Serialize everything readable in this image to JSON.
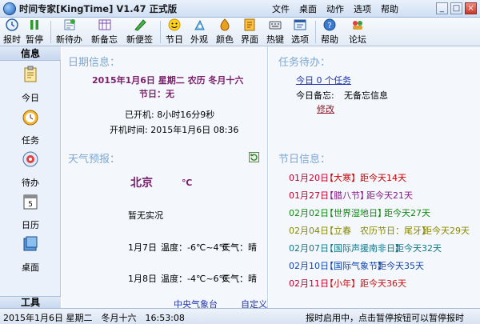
{
  "window": {
    "title": "时间专家[KingTime] V1.47 正式版",
    "menu": [
      "文件",
      "桌面",
      "动作",
      "选项",
      "帮助"
    ],
    "controls": [
      "_",
      "□",
      "×"
    ]
  },
  "toolbar": {
    "buttons": [
      {
        "label": "报时",
        "icon": "clock-icon"
      },
      {
        "label": "暂停",
        "icon": "pause-icon"
      },
      {
        "label": "新待办",
        "icon": "new-todo-icon"
      },
      {
        "label": "新备忘",
        "icon": "new-memo-icon"
      },
      {
        "label": "新便签",
        "icon": "new-note-icon"
      },
      {
        "label": "节日",
        "icon": "smiley-icon"
      },
      {
        "label": "外观",
        "icon": "appearance-icon"
      },
      {
        "label": "颜色",
        "icon": "color-icon"
      },
      {
        "label": "界面",
        "icon": "interface-icon"
      },
      {
        "label": "热键",
        "icon": "hotkey-icon"
      },
      {
        "label": "选项",
        "icon": "options-icon"
      },
      {
        "label": "帮助",
        "icon": "help-icon"
      },
      {
        "label": "论坛",
        "icon": "forum-icon"
      }
    ]
  },
  "sidebar": {
    "header": "信息",
    "items": [
      {
        "label": "今日",
        "icon": "today-icon"
      },
      {
        "label": "任务",
        "icon": "task-icon"
      },
      {
        "label": "待办",
        "icon": "todo-icon"
      },
      {
        "label": "日历",
        "icon": "calendar-icon"
      },
      {
        "label": "桌面",
        "icon": "desktop-icon"
      }
    ],
    "footer": "工具"
  },
  "date_info": {
    "title": "日期信息：",
    "date_line": "2015年1月6日 星期二 农历 冬月十六",
    "festival": "节日：无",
    "uptime": "已开机: 8小时16分9秒",
    "boot_time": "开机时间: 2015年1月6日 08:36"
  },
  "weather": {
    "title": "天气预报：",
    "city": "北京",
    "temp_unit": "℃",
    "current": "暂无实况",
    "forecast": [
      {
        "date": "1月7日",
        "temp": "温度：-6℃~4℃",
        "cond": "天气：晴"
      },
      {
        "date": "1月8日",
        "temp": "温度：-4℃~6℃",
        "cond": "天气：晴"
      }
    ],
    "source_link": "中央气象台",
    "custom_link": "自定义"
  },
  "tasks": {
    "title": "任务待办：",
    "today_tasks": "今日 0 个任务",
    "memo_label": "今日备忘:",
    "memo_value": "无备忘信息",
    "edit_link": "修改"
  },
  "holidays": {
    "title": "节日信息：",
    "items": [
      {
        "date": "01月20日",
        "name": "【大寒】",
        "days": "距今天14天",
        "color": "#cc0000"
      },
      {
        "date": "01月27日",
        "name": "【腊八节】",
        "days": "距今天21天",
        "color": "#8a1a8a"
      },
      {
        "date": "02月02日",
        "name": "【世界湿地日】",
        "days": "距今天27天",
        "color": "#118811"
      },
      {
        "date": "02月04日",
        "name": "【立春　农历节日：尾牙】",
        "days": "距今天29天",
        "color": "#888800"
      },
      {
        "date": "02月07日",
        "name": "【国际声援南非日】",
        "days": "距今天32天",
        "color": "#117788"
      },
      {
        "date": "02月10日",
        "name": "【国际气象节】",
        "days": "距今天35天",
        "color": "#1144aa"
      },
      {
        "date": "02月11日",
        "name": "【小年】",
        "days": "距今天36天",
        "color": "#cc1111"
      }
    ]
  },
  "status": {
    "left": "2015年1月6日 星期二　冬月十六　16:53:08",
    "right": "报时启用中，点击暂停按钮可以暂停报时"
  },
  "colors": {
    "section_title": "#7fa6cf",
    "date_purple": "#7a1f6a",
    "link_blue": "#2233aa"
  }
}
